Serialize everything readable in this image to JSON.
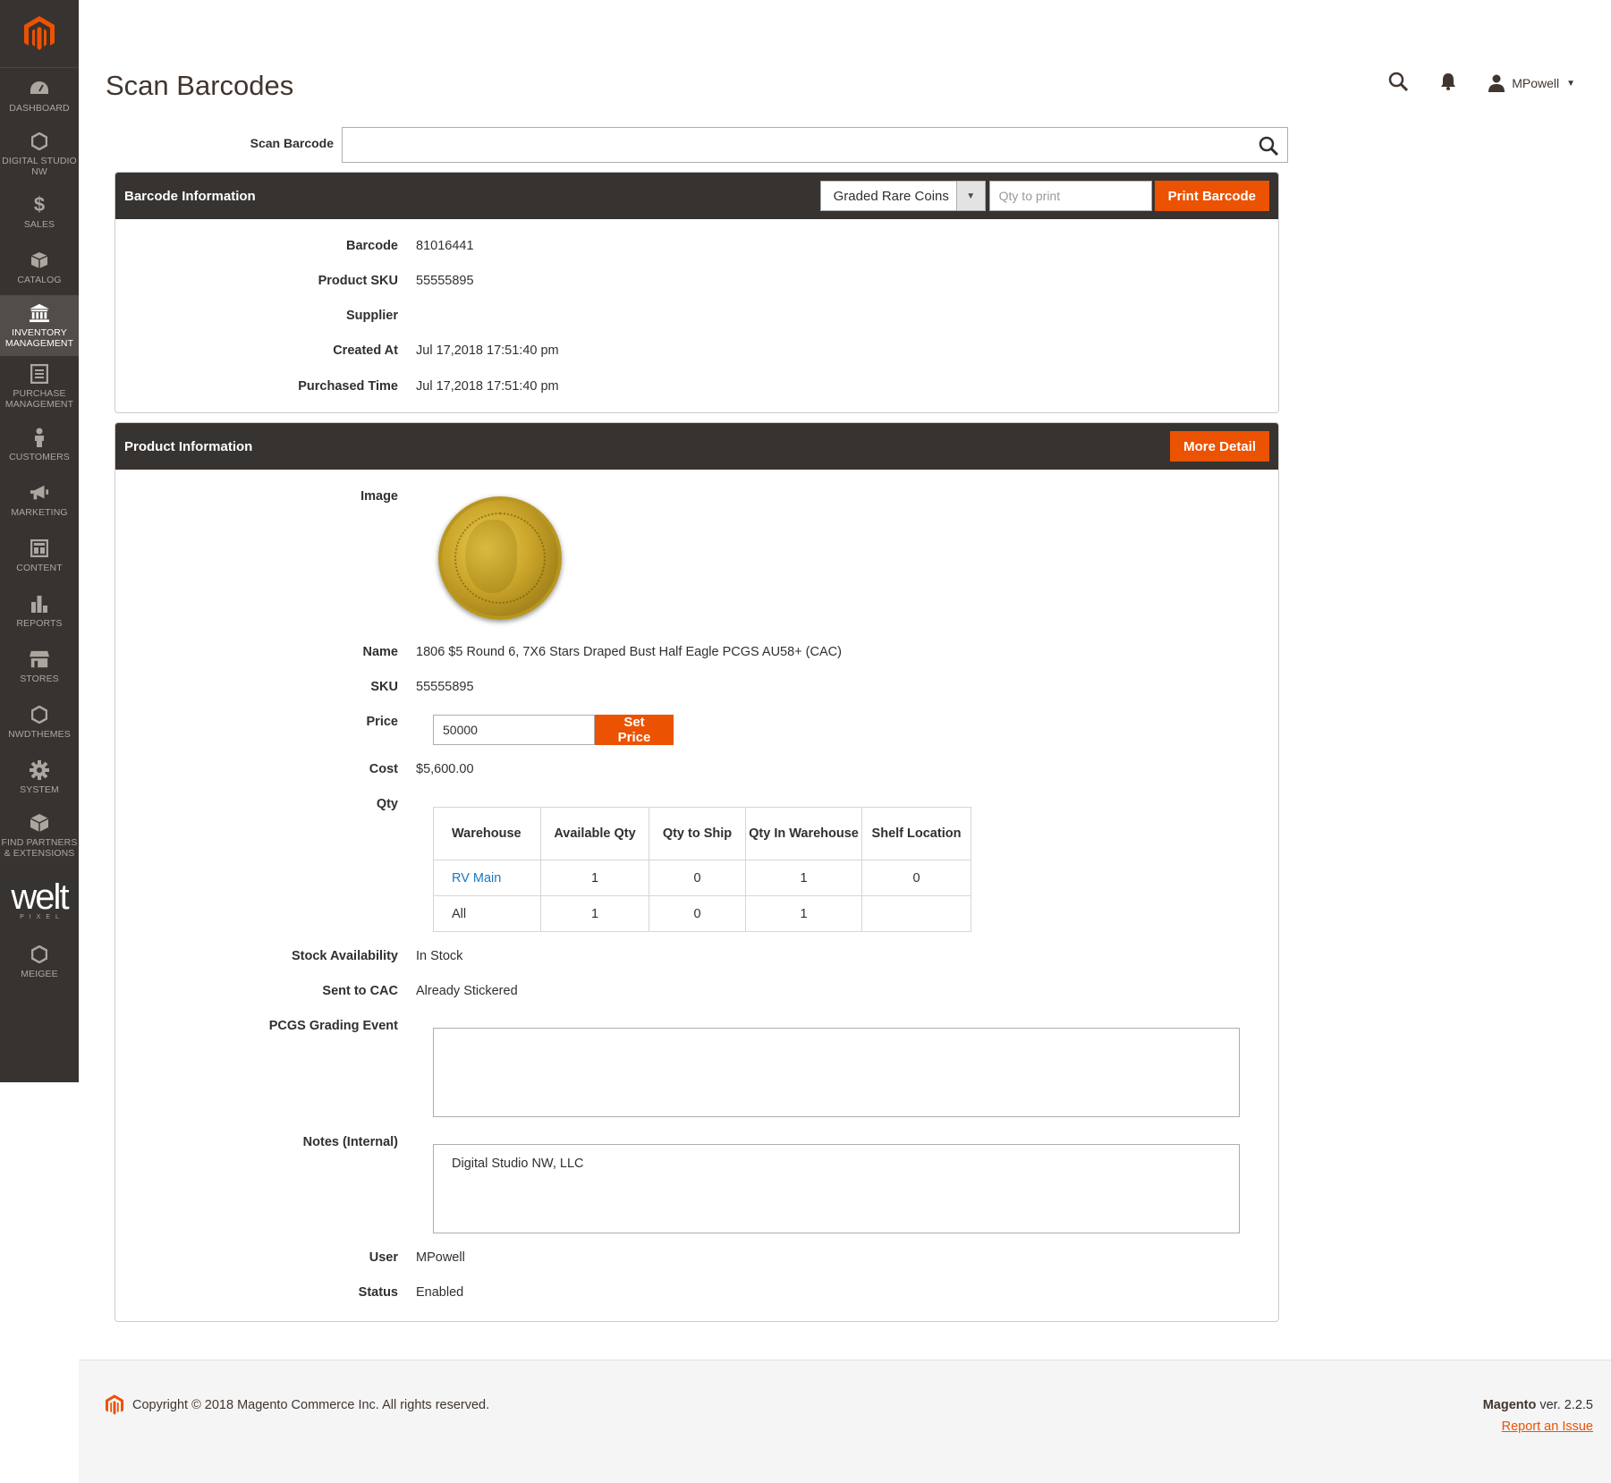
{
  "sidebar": {
    "items": [
      {
        "label": "DASHBOARD",
        "icon": "dashboard-icon"
      },
      {
        "label": "DIGITAL STUDIO NW",
        "icon": "hexagon-icon"
      },
      {
        "label": "SALES",
        "icon": "dollar-icon"
      },
      {
        "label": "CATALOG",
        "icon": "box-icon"
      },
      {
        "label": "INVENTORY MANAGEMENT",
        "icon": "bank-icon"
      },
      {
        "label": "PURCHASE MANAGEMENT",
        "icon": "document-icon"
      },
      {
        "label": "CUSTOMERS",
        "icon": "person-icon"
      },
      {
        "label": "MARKETING",
        "icon": "megaphone-icon"
      },
      {
        "label": "CONTENT",
        "icon": "layout-icon"
      },
      {
        "label": "REPORTS",
        "icon": "bar-chart-icon"
      },
      {
        "label": "STORES",
        "icon": "store-icon"
      },
      {
        "label": "NWDTHEMES",
        "icon": "hexagon-icon"
      },
      {
        "label": "SYSTEM",
        "icon": "gear-icon"
      },
      {
        "label": "FIND PARTNERS & EXTENSIONS",
        "icon": "cube-icon"
      },
      {
        "label": "MEIGEE",
        "icon": "hexagon-icon"
      }
    ],
    "brand_welt": "welt",
    "brand_pixel": "PIXEL",
    "active": "INVENTORY MANAGEMENT"
  },
  "header": {
    "title": "Scan Barcodes",
    "user": "MPowell"
  },
  "scan": {
    "label": "Scan Barcode",
    "value": ""
  },
  "barcode_panel": {
    "title": "Barcode Information",
    "select_value": "Graded Rare Coins",
    "qty_placeholder": "Qty to print",
    "print_button": "Print Barcode",
    "fields": [
      {
        "label": "Barcode",
        "value": "81016441"
      },
      {
        "label": "Product SKU",
        "value": "55555895"
      },
      {
        "label": "Supplier",
        "value": ""
      },
      {
        "label": "Created At",
        "value": "Jul 17,2018 17:51:40 pm"
      },
      {
        "label": "Purchased Time",
        "value": "Jul 17,2018 17:51:40 pm"
      }
    ]
  },
  "product_panel": {
    "title": "Product Information",
    "more_button": "More Detail",
    "image_label": "Image",
    "name_label": "Name",
    "name": "1806 $5 Round 6, 7X6 Stars Draped Bust Half Eagle PCGS AU58+ (CAC)",
    "sku_label": "SKU",
    "sku": "55555895",
    "price_label": "Price",
    "price": "50000",
    "set_price_button": "Set Price",
    "cost_label": "Cost",
    "cost": "$5,600.00",
    "qty_label": "Qty",
    "qty_table": {
      "headers": [
        "Warehouse",
        "Available Qty",
        "Qty to Ship",
        "Qty In Warehouse",
        "Shelf Location"
      ],
      "rows": [
        [
          "RV Main",
          "1",
          "0",
          "1",
          "0"
        ],
        [
          "All",
          "1",
          "0",
          "1",
          ""
        ]
      ]
    },
    "stock_label": "Stock Availability",
    "stock": "In Stock",
    "cac_label": "Sent to CAC",
    "cac": "Already Stickered",
    "pcgs_label": "PCGS Grading Event",
    "pcgs": "",
    "notes_label": "Notes (Internal)",
    "notes": "Digital Studio NW, LLC",
    "user_label": "User",
    "user": "MPowell",
    "status_label": "Status",
    "status": "Enabled"
  },
  "footer": {
    "copyright": "Copyright © 2018 Magento Commerce Inc. All rights reserved.",
    "brand": "Magento",
    "version": "ver. 2.2.5",
    "report": "Report an Issue"
  },
  "colors": {
    "accent": "#eb5202",
    "sidebar": "#373330",
    "link": "#1979c3"
  }
}
